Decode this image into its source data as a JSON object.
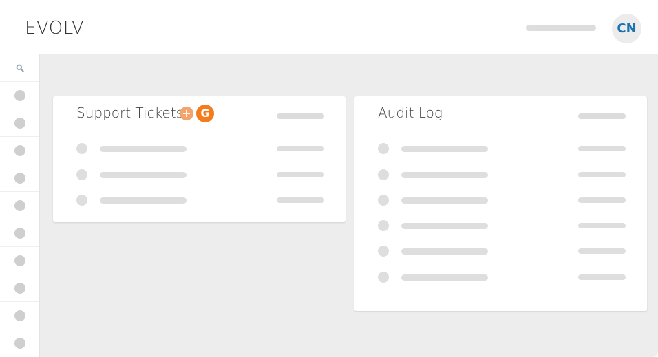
{
  "header": {
    "brand": "EVOLV",
    "avatar_initials": "CN"
  },
  "sidebar": {
    "search_icon": "search-icon",
    "item_count": 10
  },
  "cards": {
    "support": {
      "title": "Support Tickets",
      "badge_plus": "+",
      "badge_g": "G",
      "rows": 3
    },
    "audit": {
      "title": "Audit Log",
      "rows": 6
    }
  },
  "colors": {
    "brand_text": "#333333",
    "avatar_text": "#1a73b0",
    "badge_plus": "#f4a46a",
    "badge_g": "#f47c1d",
    "main_bg": "#ededed",
    "skeleton": "#dedede"
  }
}
